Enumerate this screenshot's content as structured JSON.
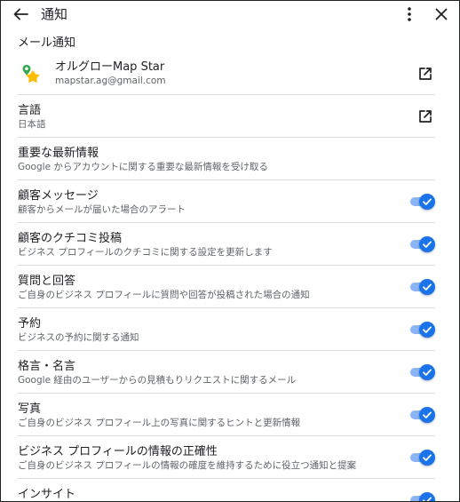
{
  "header": {
    "title": "通知",
    "back_icon": "arrow-left-icon",
    "more_icon": "more-vert-icon",
    "close_icon": "close-icon"
  },
  "email_section": {
    "label": "メール通知"
  },
  "account": {
    "name": "オルグローMap Star",
    "email": "mapstar.ag@gmail.com",
    "avatar_icon": "map-star-logo-icon",
    "link_icon": "open-in-new-icon"
  },
  "language": {
    "title": "言語",
    "value": "日本語",
    "link_icon": "open-in-new-icon"
  },
  "important": {
    "title": "重要な最新情報",
    "description": "Google からアカウントに関する重要な最新情報を受け取る"
  },
  "settings": [
    {
      "title": "顧客メッセージ",
      "description": "顧客からメールが届いた場合のアラート",
      "enabled": true
    },
    {
      "title": "顧客のクチコミ投稿",
      "description": "ビジネス プロフィールのクチコミに関する設定を更新します",
      "enabled": true
    },
    {
      "title": "質問と回答",
      "description": "ご自身のビジネス プロフィールに質問や回答が投稿された場合の通知",
      "enabled": true
    },
    {
      "title": "予約",
      "description": "ビジネスの予約に関する通知",
      "enabled": true
    },
    {
      "title": "格言・名言",
      "description": "Google 経由のユーザーからの見積もりリクエストに関するメール",
      "enabled": true
    },
    {
      "title": "写真",
      "description": "ご自身のビジネス プロフィール上の写真に関するヒントと更新情報",
      "enabled": true
    },
    {
      "title": "ビジネス プロフィールの情報の正確性",
      "description": "ご自身のビジネス プロフィールの情報の確度を維持するために役立つ通知と提案",
      "enabled": true
    },
    {
      "title": "インサイト",
      "description": "",
      "enabled": true
    }
  ],
  "colors": {
    "toggle_on": "#1a73e8",
    "toggle_track": "#8ab4f8",
    "divider": "#dadce0"
  }
}
